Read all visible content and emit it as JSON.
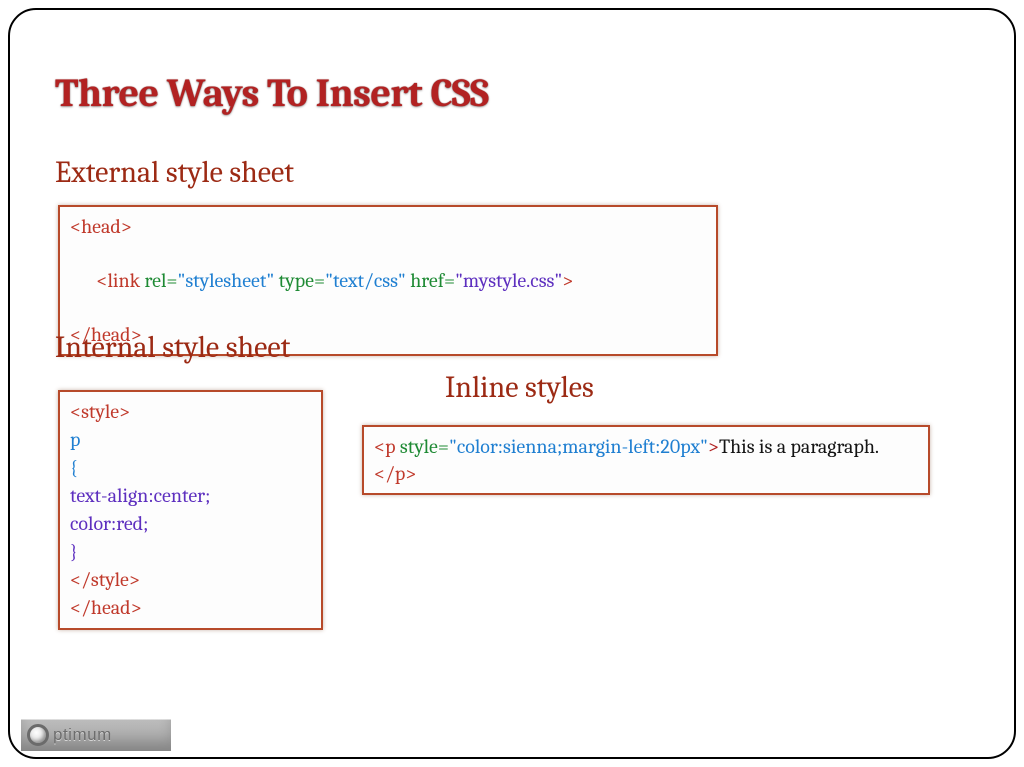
{
  "title": "Three Ways To Insert CSS",
  "sections": {
    "external": {
      "heading": "External style sheet",
      "code": {
        "line1": "<head>",
        "line2_a": "<link ",
        "line2_attr1": "rel=",
        "line2_val1": "\"stylesheet\"",
        "line2_space1": " ",
        "line2_attr2": "type=",
        "line2_val2": "\"text/css\"",
        "line2_space2": " ",
        "line2_attr3": "href=",
        "line2_val3": "\"mystyle.css\"",
        "line2_close": ">",
        "line3": "</head>"
      }
    },
    "internal": {
      "heading": "Internal style sheet",
      "code": {
        "l1": "<style>",
        "l2": "p",
        "l3": "{",
        "l4": "text-align:center;",
        "l5": "color:red;",
        "l6": "}",
        "l7": "</style>",
        "l8": "</head>"
      }
    },
    "inline": {
      "heading": "Inline styles",
      "code": {
        "open_p": "<p ",
        "attr": "style=",
        "val": "\"color:sienna;margin-left:20px\"",
        "close_open": ">",
        "content": "This is a paragraph. ",
        "close_p": "</p>"
      }
    }
  },
  "logo_text": "ptimum"
}
